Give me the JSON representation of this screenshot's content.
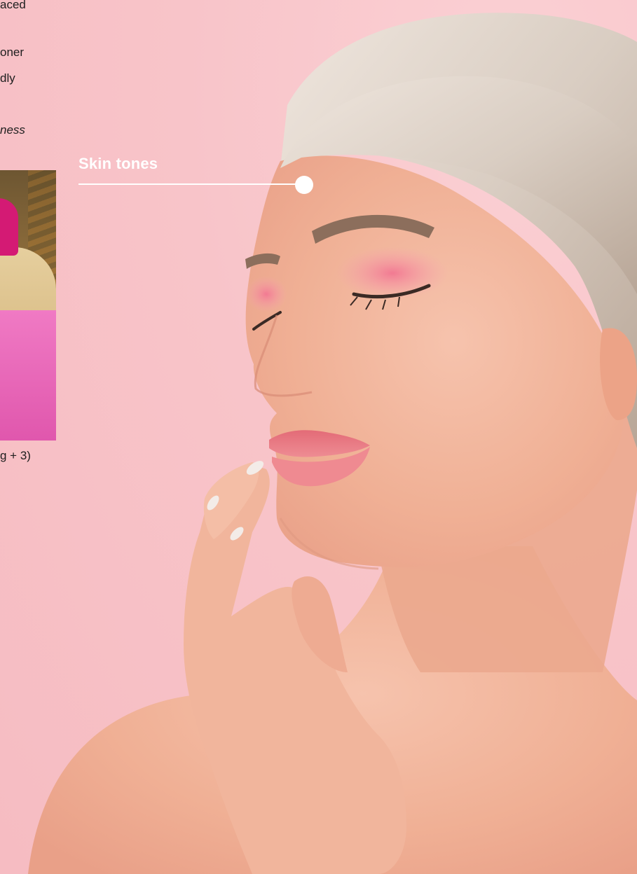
{
  "article": {
    "line1": "aced",
    "line2": "oner",
    "line3": "dly",
    "line4": "ness",
    "caption": "g + 3)"
  },
  "annotation": {
    "label": "Skin tones"
  },
  "colors": {
    "background": "#f8c3c8",
    "label": "#ffffff",
    "skin": "#f2b39a",
    "hair": "#e7ddd4",
    "lips": "#e9727c",
    "eyeshadow": "#f06c86"
  }
}
